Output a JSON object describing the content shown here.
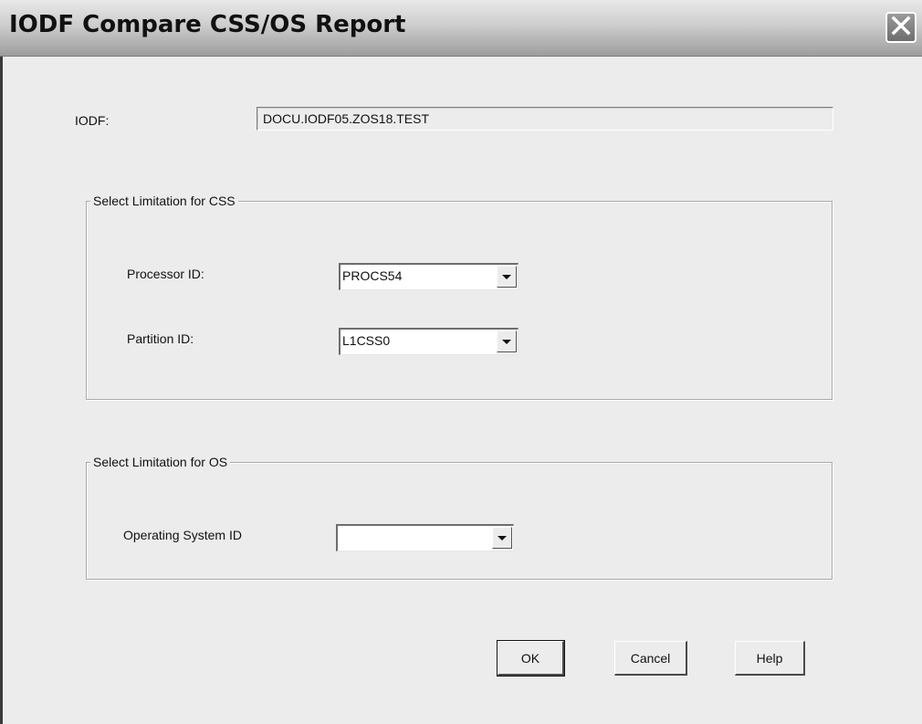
{
  "window": {
    "title": "IODF Compare CSS/OS Report"
  },
  "iodf": {
    "label": "IODF:",
    "value": "DOCU.IODF05.ZOS18.TEST"
  },
  "css_group": {
    "legend": "Select Limitation for CSS",
    "processor_label": "Processor ID:",
    "processor_value": "PROCS54",
    "partition_label": "Partition ID:",
    "partition_value": "L1CSS0"
  },
  "os_group": {
    "legend": "Select Limitation for OS",
    "os_label": "Operating System ID",
    "os_value": ""
  },
  "buttons": {
    "ok": "OK",
    "cancel": "Cancel",
    "help": "Help"
  }
}
